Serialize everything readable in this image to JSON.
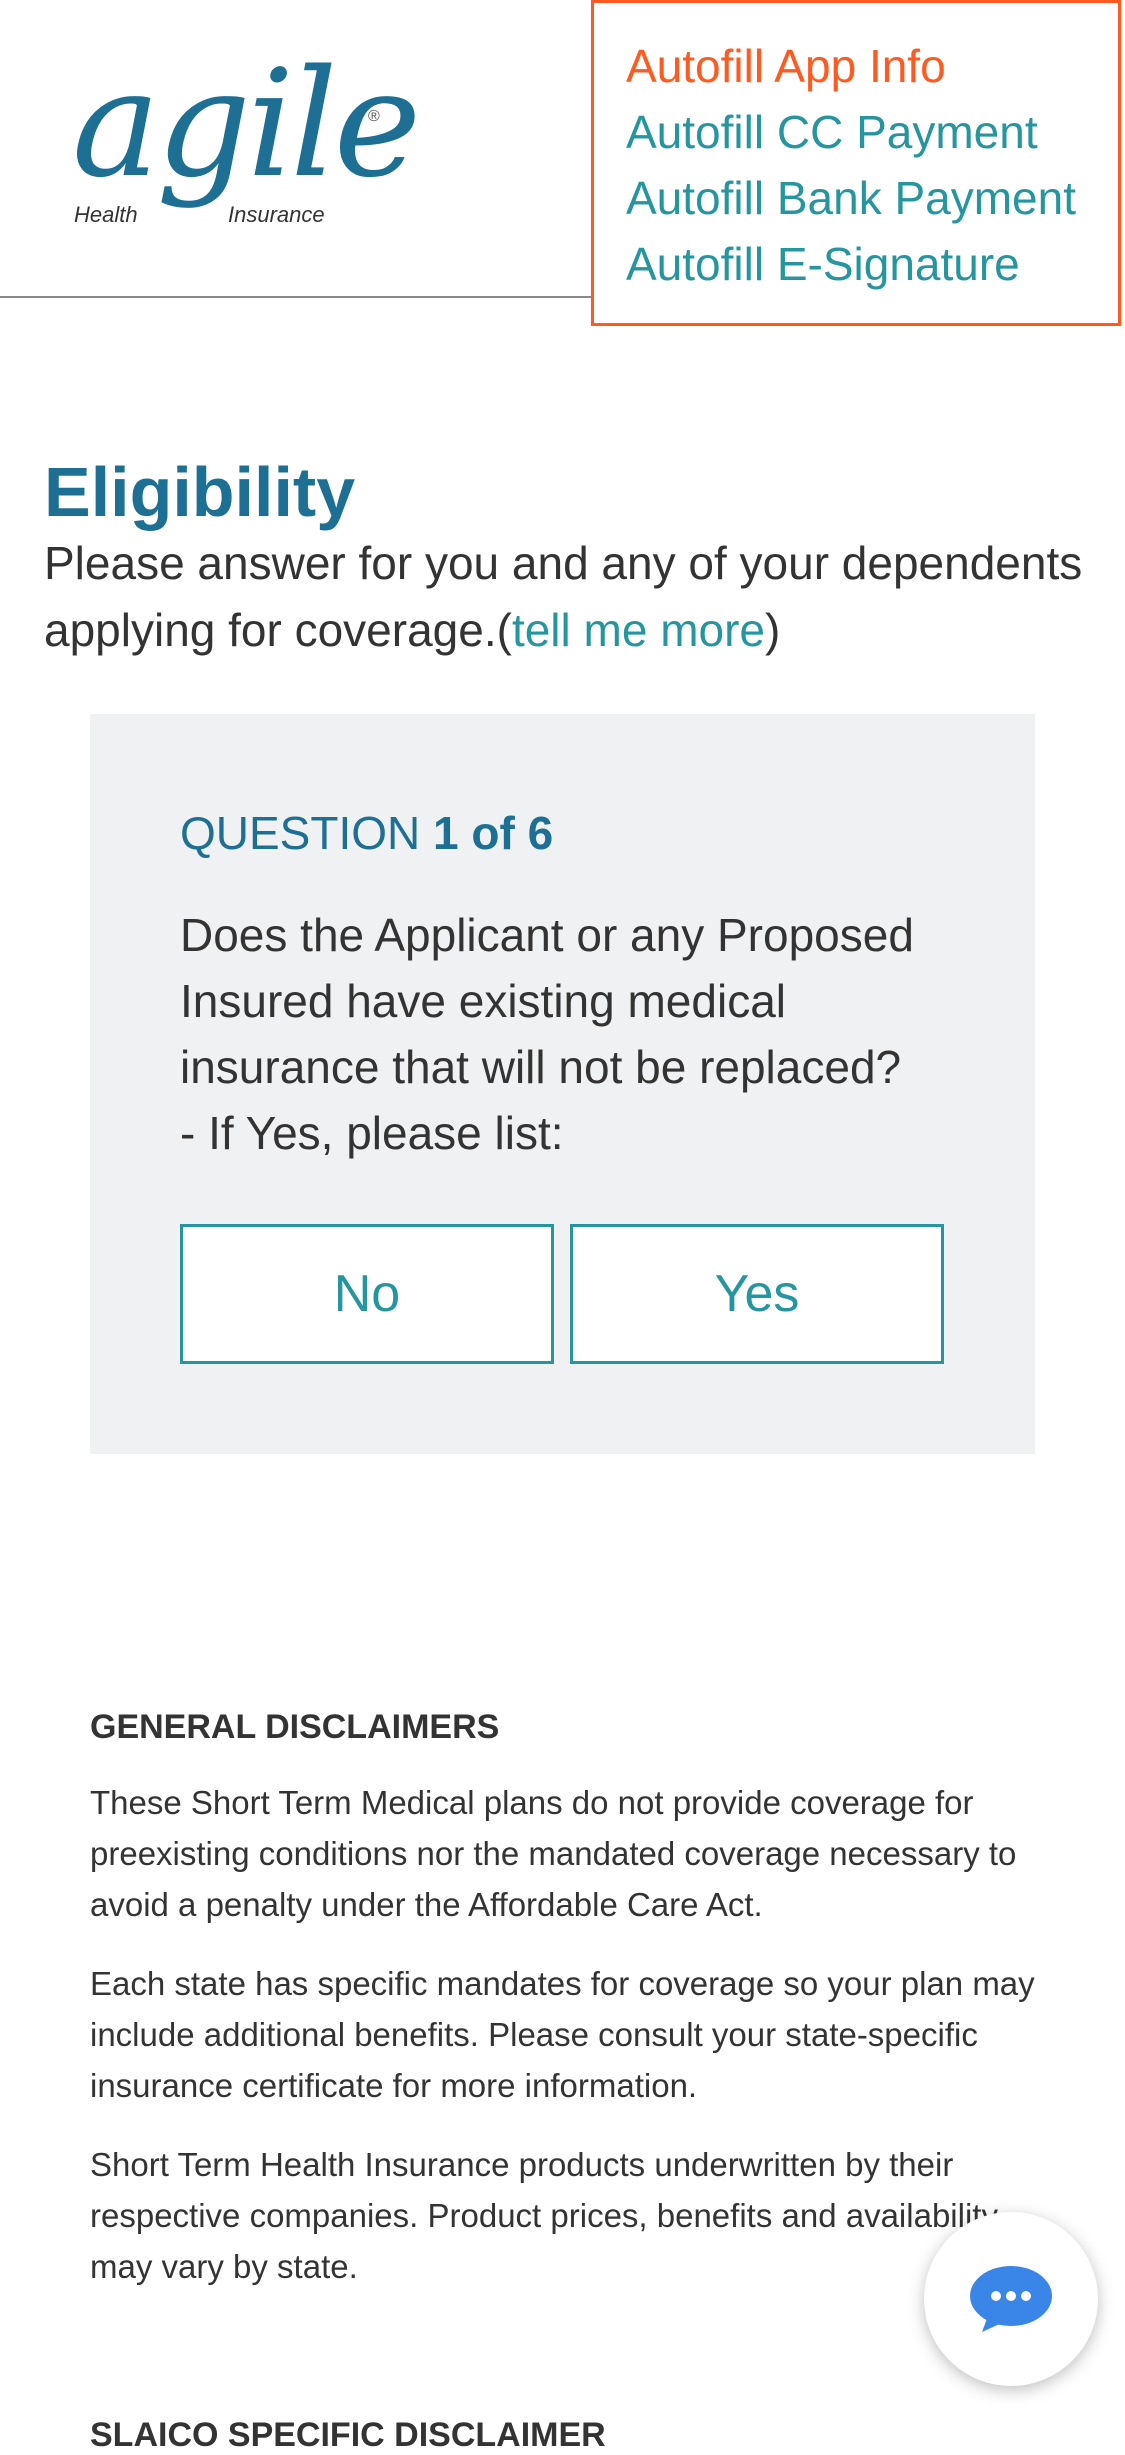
{
  "logo": {
    "word": "agile",
    "registered": "®",
    "sub_left": "Health",
    "sub_right": "Insurance"
  },
  "autofill": {
    "items": [
      "Autofill App Info",
      "Autofill CC Payment",
      "Autofill Bank Payment",
      "Autofill E-Signature"
    ]
  },
  "page": {
    "title": "Eligibility",
    "intro_text": "Please answer for you and any of your dependents applying for coverage.(",
    "intro_link": "tell me more",
    "intro_close": ")"
  },
  "question": {
    "label": "QUESTION",
    "count": "1 of 6",
    "text": "Does the Applicant or any Proposed Insured have existing medical insurance that will not be replaced?\n- If Yes, please list:",
    "no_label": "No",
    "yes_label": "Yes"
  },
  "disclaimers": {
    "heading": "GENERAL DISCLAIMERS",
    "paragraphs": [
      "These Short Term Medical plans do not provide coverage for preexisting conditions nor the mandated coverage necessary to avoid a penalty under the Affordable Care Act.",
      "Each state has specific mandates for coverage so your plan may include additional benefits. Please consult your state-specific insurance certificate for more information.",
      "Short Term Health Insurance products underwritten by their respective companies. Product prices, benefits and availability may vary by state."
    ],
    "next_heading": "SLAICO SPECIFIC DISCLAIMER"
  },
  "chat": {
    "icon": "chat-bubble-icon",
    "color": "#3a86e8"
  },
  "colors": {
    "brand": "#1e6f94",
    "accent": "#2596a0",
    "autofill_highlight": "#ff5a1f"
  }
}
